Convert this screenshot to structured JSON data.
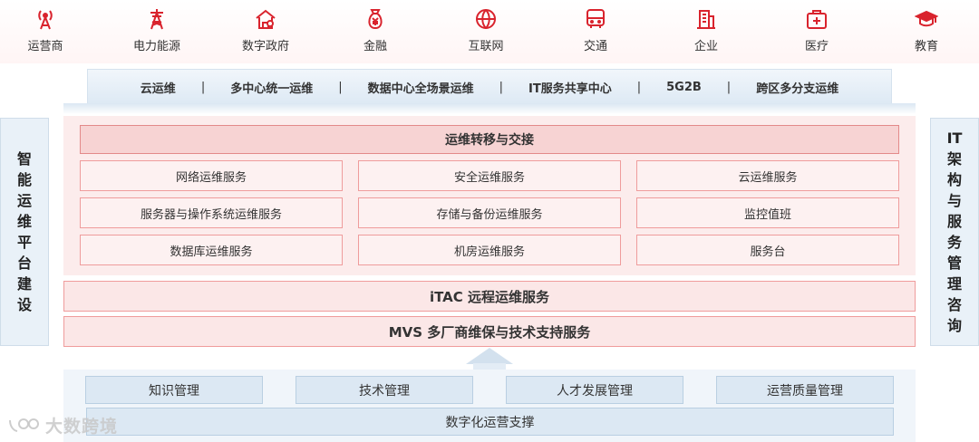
{
  "industries": [
    {
      "label": "运营商",
      "icon": "signal-tower-icon"
    },
    {
      "label": "电力能源",
      "icon": "power-pylon-icon"
    },
    {
      "label": "数字政府",
      "icon": "government-building-icon"
    },
    {
      "label": "金融",
      "icon": "money-bag-icon"
    },
    {
      "label": "互联网",
      "icon": "globe-icon"
    },
    {
      "label": "交通",
      "icon": "bus-icon"
    },
    {
      "label": "企业",
      "icon": "office-building-icon"
    },
    {
      "label": "医疗",
      "icon": "medical-kit-icon"
    },
    {
      "label": "教育",
      "icon": "graduation-cap-icon"
    }
  ],
  "band": {
    "items": [
      "云运维",
      "多中心统一运维",
      "数据中心全场景运维",
      "IT服务共享中心",
      "5G2B",
      "跨区多分支运维"
    ],
    "separator": "|"
  },
  "left_panel": {
    "text": "智能运维平台建设"
  },
  "right_panel": {
    "text": "IT架构与服务管理咨询"
  },
  "transfer": {
    "label": "运维转移与交接"
  },
  "services": [
    "网络运维服务",
    "安全运维服务",
    "云运维服务",
    "服务器与操作系统运维服务",
    "存储与备份运维服务",
    "监控值班",
    "数据库运维服务",
    "机房运维服务",
    "服务台"
  ],
  "itac": {
    "label": "iTAC 远程运维服务"
  },
  "mvs": {
    "label": "MVS 多厂商维保与技术支持服务"
  },
  "management": [
    "知识管理",
    "技术管理",
    "人才发展管理",
    "运营质量管理"
  ],
  "digital": {
    "label": "数字化运营支撑"
  },
  "watermark": {
    "text": "大数跨境"
  },
  "colors": {
    "accent_red": "#d9232d",
    "panel_pink": "#fcecec",
    "panel_blue": "#e9f1f8"
  }
}
